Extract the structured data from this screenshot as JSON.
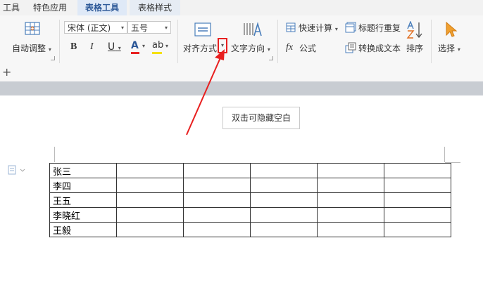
{
  "tabs": [
    {
      "label": "工具"
    },
    {
      "label": "特色应用"
    },
    {
      "label": "表格工具"
    },
    {
      "label": "表格样式"
    }
  ],
  "ribbon": {
    "auto_adjust": "自动调整",
    "font_name": "宋体 (正文)",
    "font_size": "五号",
    "bold": "B",
    "italic": "I",
    "underline": "U",
    "font_color_glyph": "A",
    "highlight_glyph": "ab",
    "align": "对齐方式",
    "text_direction": "文字方向",
    "quick_calc": "快速计算",
    "title_repeat": "标题行重复",
    "formula_glyph": "fx",
    "formula": "公式",
    "convert_text": "转换成文本",
    "sort": "排序",
    "select": "选择"
  },
  "document": {
    "hint": "双击可隐藏空白",
    "table_rows": [
      "张三",
      "李四",
      "王五",
      "李晓红",
      "王毅"
    ]
  },
  "colors": {
    "accent": "#2b5797",
    "arrow": "#e81f1f",
    "font_color_bar": "#e82222",
    "highlight_bar": "#f5e100"
  }
}
